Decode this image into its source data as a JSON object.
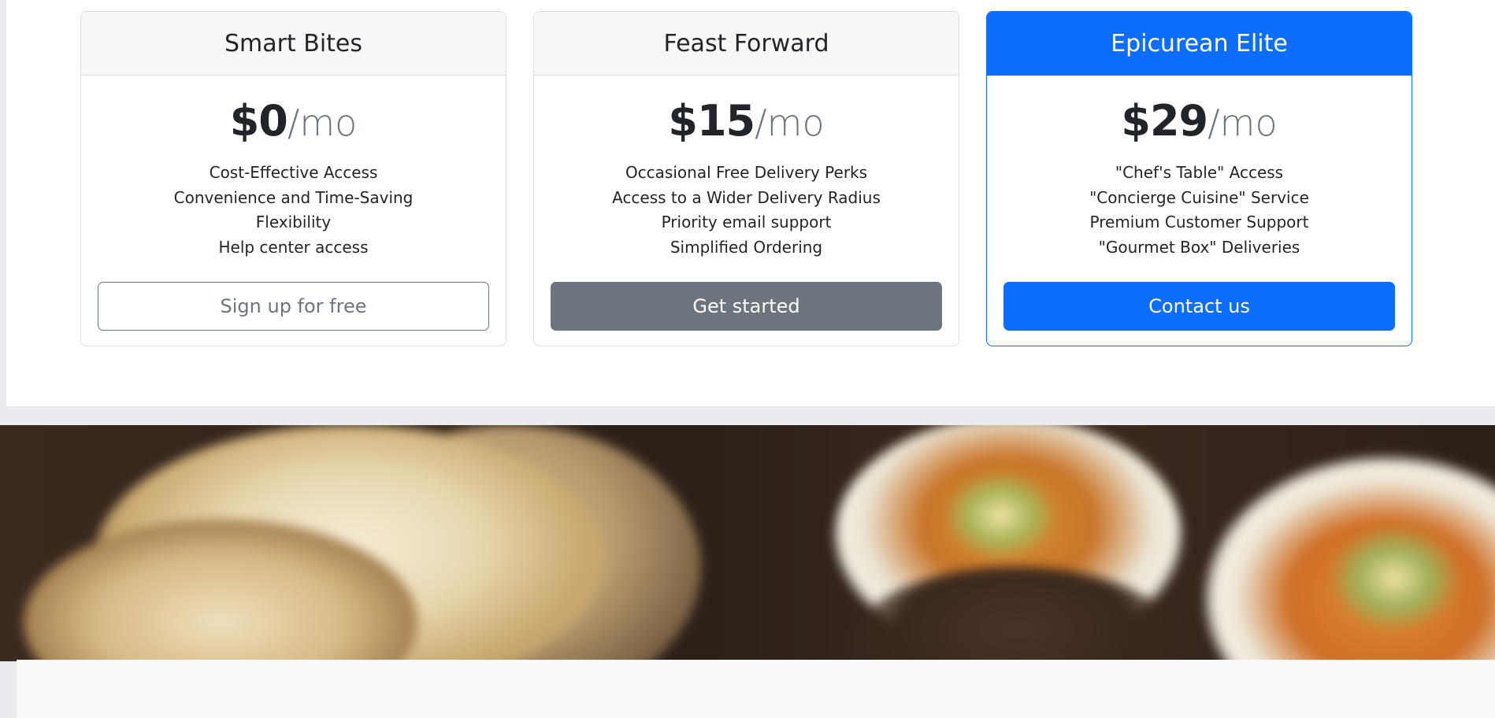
{
  "plans": [
    {
      "name": "Smart Bites",
      "price": "$0",
      "period": "/mo",
      "features": [
        "Cost-Effective Access",
        "Convenience and Time-Saving",
        "Flexibility",
        "Help center access"
      ],
      "button": "Sign up for free"
    },
    {
      "name": "Feast Forward",
      "price": "$15",
      "period": "/mo",
      "features": [
        "Occasional Free Delivery Perks",
        "Access to a Wider Delivery Radius",
        "Priority email support",
        "Simplified Ordering"
      ],
      "button": "Get started"
    },
    {
      "name": "Epicurean Elite",
      "price": "$29",
      "period": "/mo",
      "features": [
        "\"Chef's Table\" Access",
        "\"Concierge Cuisine\" Service",
        "Premium Customer Support",
        "\"Gourmet Box\" Deliveries"
      ],
      "button": "Contact us"
    }
  ],
  "colors": {
    "primary": "#0d6efd",
    "secondary": "#6c757d",
    "header_bg": "#f7f7f7"
  }
}
